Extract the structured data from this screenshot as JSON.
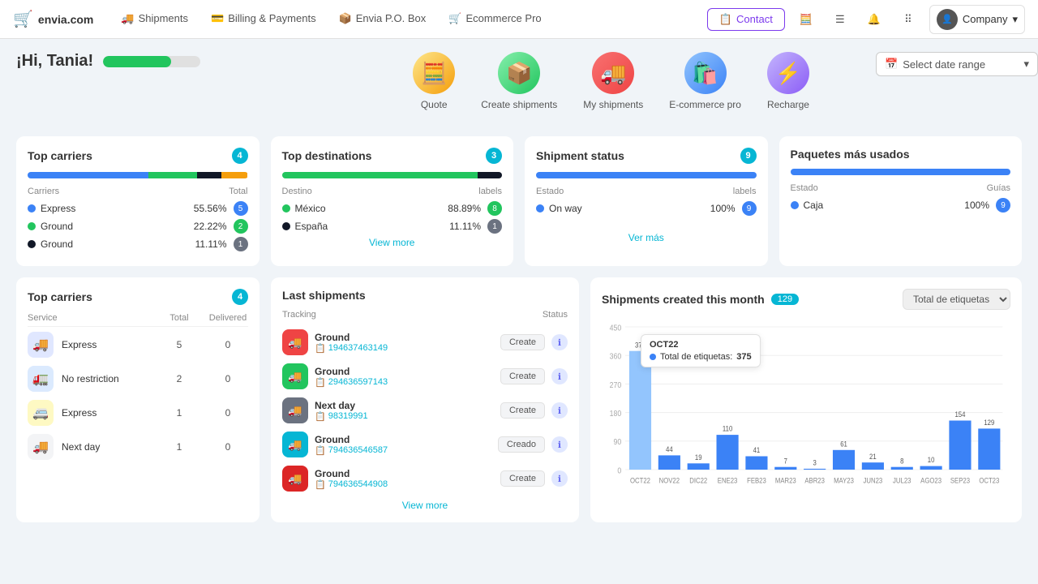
{
  "navbar": {
    "logo": "envia.com",
    "nav_items": [
      {
        "label": "Shipments",
        "icon": "🚚"
      },
      {
        "label": "Billing & Payments",
        "icon": "💳"
      },
      {
        "label": "Envia P.O. Box",
        "icon": "📦"
      },
      {
        "label": "Ecommerce Pro",
        "icon": "🛒"
      }
    ],
    "contact_label": "Contact",
    "company_label": "Company"
  },
  "greeting": {
    "text": "¡Hi, Tania!",
    "progress": 70
  },
  "quick_nav": [
    {
      "label": "Quote",
      "emoji": "🧮",
      "color": "#fde68a"
    },
    {
      "label": "Create shipments",
      "emoji": "📦",
      "color": "#86efac"
    },
    {
      "label": "My shipments",
      "emoji": "🚚",
      "color": "#fca5a5"
    },
    {
      "label": "E-commerce pro",
      "emoji": "🛍️",
      "color": "#93c5fd"
    },
    {
      "label": "Recharge",
      "emoji": "⚡",
      "color": "#c4b5fd"
    }
  ],
  "date_picker": {
    "placeholder": "Select date range"
  },
  "top_carriers_card": {
    "title": "Top carriers",
    "badge": "4",
    "bar_segments": [
      {
        "color": "#3b82f6",
        "pct": 55
      },
      {
        "color": "#22c55e",
        "pct": 22
      },
      {
        "color": "#111827",
        "pct": 11
      },
      {
        "color": "#f59e0b",
        "pct": 12
      }
    ],
    "col_left": "Carriers",
    "col_right": "Total",
    "rows": [
      {
        "dot": "#3b82f6",
        "name": "Express",
        "pct": "55.56%",
        "badge": "5",
        "badge_color": "#3b82f6"
      },
      {
        "dot": "#22c55e",
        "name": "Ground",
        "pct": "22.22%",
        "badge": "2",
        "badge_color": "#22c55e"
      },
      {
        "dot": "#111827",
        "name": "Ground",
        "pct": "11.11%",
        "badge": "1",
        "badge_color": "#111827"
      }
    ]
  },
  "top_destinations_card": {
    "title": "Top destinations",
    "badge": "3",
    "bar_segments": [
      {
        "color": "#22c55e",
        "pct": 89
      },
      {
        "color": "#111827",
        "pct": 11
      }
    ],
    "col_left": "Destino",
    "col_right": "labels",
    "rows": [
      {
        "dot": "#22c55e",
        "name": "México",
        "pct": "88.89%",
        "badge": "8",
        "badge_color": "#22c55e"
      },
      {
        "dot": "#111827",
        "name": "España",
        "pct": "11.11%",
        "badge": "1",
        "badge_color": "#111827"
      }
    ],
    "view_more": "View more"
  },
  "shipment_status_card": {
    "title": "Shipment status",
    "badge": "9",
    "bar_segments": [
      {
        "color": "#3b82f6",
        "pct": 100
      }
    ],
    "col_left": "Estado",
    "col_right": "labels",
    "rows": [
      {
        "dot": "#3b82f6",
        "name": "On way",
        "pct": "100%",
        "badge": "9",
        "badge_color": "#3b82f6"
      }
    ],
    "ver_mas": "Ver más"
  },
  "paquetes_card": {
    "title": "Paquetes más usados",
    "bar_segments": [
      {
        "color": "#3b82f6",
        "pct": 100
      }
    ],
    "col_left": "Estado",
    "col_right": "Guías",
    "rows": [
      {
        "dot": "#3b82f6",
        "name": "Caja",
        "pct": "100%",
        "badge": "9",
        "badge_color": "#3b82f6"
      }
    ]
  },
  "top_carriers_bottom": {
    "title": "Top carriers",
    "badge": "4",
    "col_service": "Service",
    "col_total": "Total",
    "col_delivered": "Delivered",
    "rows": [
      {
        "emoji": "🚚",
        "bg": "#f0f4ff",
        "name": "Express",
        "total": "5",
        "delivered": "0"
      },
      {
        "emoji": "🚛",
        "bg": "#eff6ff",
        "name": "No restriction",
        "total": "2",
        "delivered": "0"
      },
      {
        "emoji": "🚐",
        "bg": "#fef9c3",
        "name": "Express",
        "total": "1",
        "delivered": "0"
      },
      {
        "emoji": "🚚",
        "bg": "#f3f4f6",
        "name": "Next day",
        "total": "1",
        "delivered": "0"
      }
    ]
  },
  "last_shipments": {
    "title": "Last shipments",
    "col_tracking": "Tracking",
    "col_status": "Status",
    "rows": [
      {
        "carrier": "Ground",
        "tracking": "194637463149",
        "status": "Create",
        "bg": "#ef4444"
      },
      {
        "carrier": "Ground",
        "tracking": "294636597143",
        "status": "Create",
        "bg": "#22c55e"
      },
      {
        "carrier": "Next day",
        "tracking": "98319991",
        "status": "Create",
        "bg": "#6b7280"
      },
      {
        "carrier": "Ground",
        "tracking": "794636546587",
        "status": "Creado",
        "bg": "#06b6d4"
      },
      {
        "carrier": "Ground",
        "tracking": "794636544908",
        "status": "Create",
        "bg": "#dc2626"
      }
    ],
    "view_more": "View more"
  },
  "chart": {
    "title": "Shipments created this month",
    "badge": "129",
    "dropdown_label": "Total de etiquetas",
    "tooltip": {
      "month": "OCT22",
      "label": "Total de etiquetas:",
      "value": "375"
    },
    "y_labels": [
      "450",
      "360",
      "270",
      "180",
      "90",
      "0"
    ],
    "bars": [
      {
        "month": "OCT22",
        "value": 375,
        "highlight": true
      },
      {
        "month": "NOV22",
        "value": 44
      },
      {
        "month": "DIC22",
        "value": 19
      },
      {
        "month": "ENE23",
        "value": 110
      },
      {
        "month": "FEB23",
        "value": 41
      },
      {
        "month": "MAR23",
        "value": 7
      },
      {
        "month": "ABR23",
        "value": 3
      },
      {
        "month": "MAY23",
        "value": 61
      },
      {
        "month": "JUN23",
        "value": 21
      },
      {
        "month": "JUL23",
        "value": 8
      },
      {
        "month": "AGO23",
        "value": 10
      },
      {
        "month": "SEP23",
        "value": 154
      },
      {
        "month": "OCT23",
        "value": 129
      }
    ]
  }
}
